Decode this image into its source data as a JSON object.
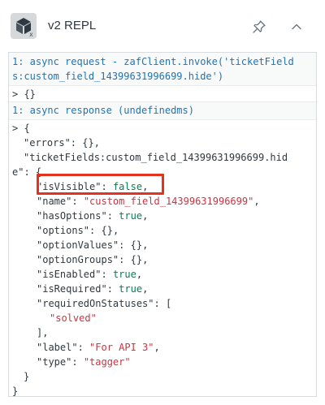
{
  "header": {
    "title": "v2 REPL",
    "icon_badge": "x",
    "icons": {
      "app": "app-cube-icon",
      "pin": "pin-icon",
      "collapse": "chevron-up-icon"
    }
  },
  "console": {
    "request": {
      "line1": "1: async request - zafClient.invoke('ticketField",
      "line2": "s:custom_field_14399631996699.hide')",
      "result": "> {}"
    },
    "response": {
      "header": "1: async response (undefinedms)",
      "open": "> {",
      "errors_key": "\"errors\"",
      "errors_val": ": {},",
      "field_key_a": "\"ticketFields:custom_field_14399631996699.hid",
      "field_key_b": "e\"",
      "field_open": ": {",
      "props": [
        {
          "k": "\"isVisible\"",
          "sep": ": ",
          "v": "false",
          "end": ",",
          "t": "kw"
        },
        {
          "k": "\"name\"",
          "sep": ": ",
          "v": "\"custom_field_14399631996699\"",
          "end": ",",
          "t": "str"
        },
        {
          "k": "\"hasOptions\"",
          "sep": ": ",
          "v": "true",
          "end": ",",
          "t": "kw"
        },
        {
          "k": "\"options\"",
          "sep": ": ",
          "v": "{}",
          "end": ",",
          "t": "plain"
        },
        {
          "k": "\"optionValues\"",
          "sep": ": ",
          "v": "{}",
          "end": ",",
          "t": "plain"
        },
        {
          "k": "\"optionGroups\"",
          "sep": ": ",
          "v": "{}",
          "end": ",",
          "t": "plain"
        },
        {
          "k": "\"isEnabled\"",
          "sep": ": ",
          "v": "true",
          "end": ",",
          "t": "kw"
        },
        {
          "k": "\"isRequired\"",
          "sep": ": ",
          "v": "true",
          "end": ",",
          "t": "kw"
        },
        {
          "k": "\"requiredOnStatuses\"",
          "sep": ": ",
          "v": "[",
          "end": "",
          "t": "plain"
        }
      ],
      "status_item": "\"solved\"",
      "array_close": "],",
      "label_key": "\"label\"",
      "label_val": "\"For API 3\"",
      "type_key": "\"type\"",
      "type_val": "\"tagger\"",
      "field_close": "}",
      "close": "}"
    }
  },
  "colors": {
    "string": "#cc3340",
    "keyword": "#038153",
    "link": "#1f73b7",
    "highlight": "#e5321d"
  }
}
